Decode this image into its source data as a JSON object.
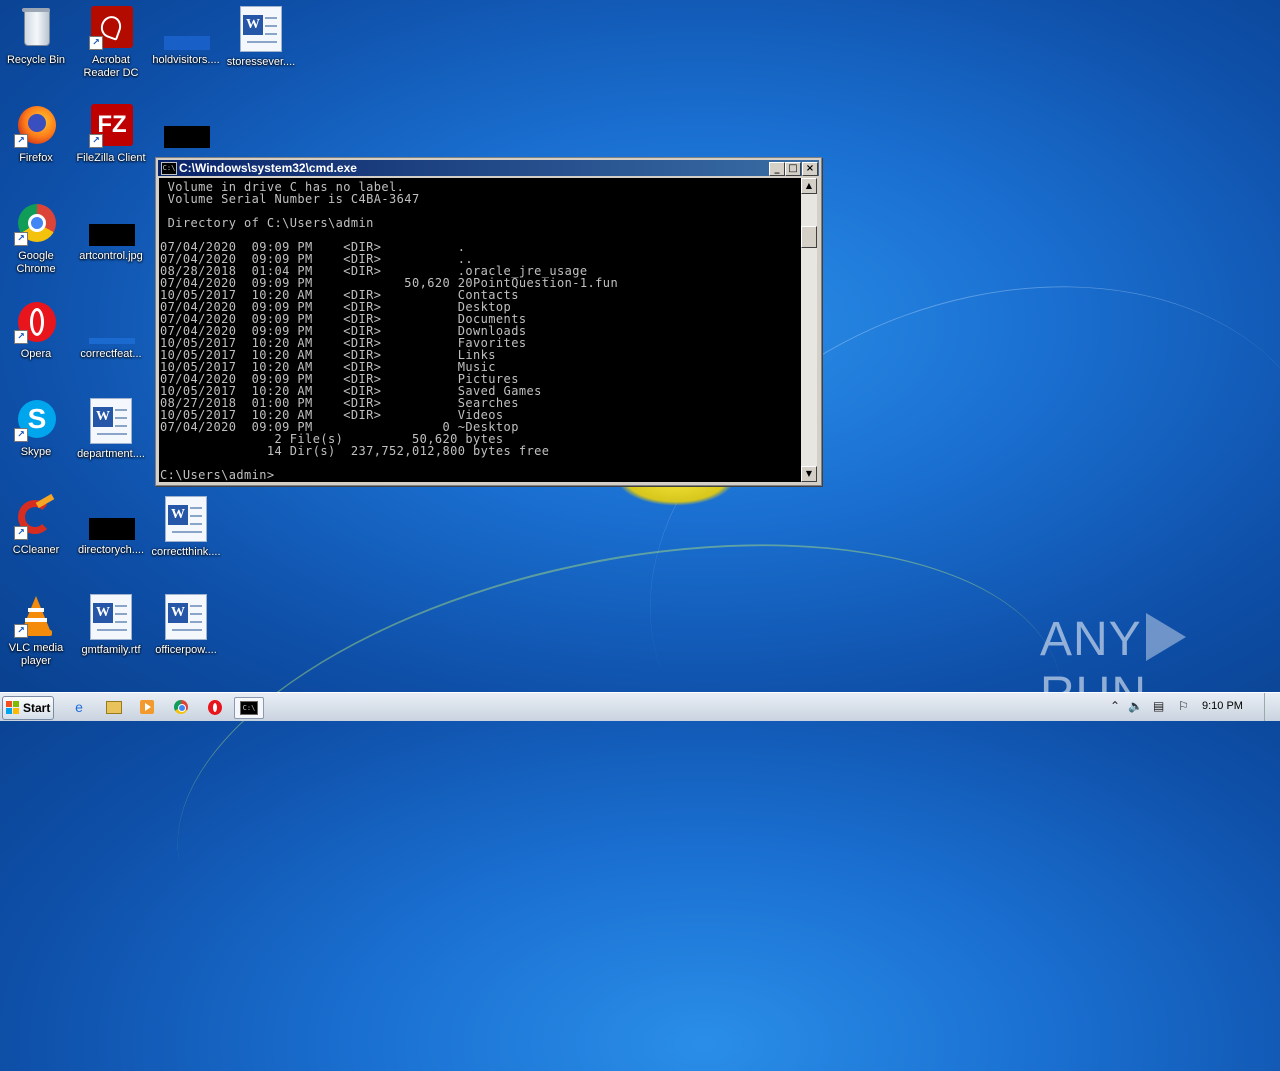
{
  "desktop": {
    "icons": [
      {
        "label": "Recycle Bin",
        "icon": "recycle-bin-icon"
      },
      {
        "label": "Acrobat Reader DC",
        "icon": "acrobat-icon"
      },
      {
        "label": "holdvisitors....",
        "icon": "file-icon"
      },
      {
        "label": "storessever....",
        "icon": "word-document-icon"
      },
      {
        "label": "Firefox",
        "icon": "firefox-icon"
      },
      {
        "label": "FileZilla Client",
        "icon": "filezilla-icon"
      },
      {
        "label": "",
        "icon": "file-icon"
      },
      {
        "label": "Google Chrome",
        "icon": "chrome-icon"
      },
      {
        "label": "artcontrol.jpg",
        "icon": "image-file-icon"
      },
      {
        "label": "Opera",
        "icon": "opera-icon"
      },
      {
        "label": "correctfeat...",
        "icon": "file-icon"
      },
      {
        "label": "Skype",
        "icon": "skype-icon"
      },
      {
        "label": "department....",
        "icon": "word-document-icon"
      },
      {
        "label": "CCleaner",
        "icon": "ccleaner-icon"
      },
      {
        "label": "directorych....",
        "icon": "file-icon"
      },
      {
        "label": "correctthink....",
        "icon": "word-document-icon"
      },
      {
        "label": "VLC media player",
        "icon": "vlc-icon"
      },
      {
        "label": "gmtfamily.rtf",
        "icon": "word-document-icon"
      },
      {
        "label": "officerpow....",
        "icon": "word-document-icon"
      }
    ]
  },
  "cmd_window": {
    "title": "C:\\Windows\\system32\\cmd.exe",
    "lines": [
      " Volume in drive C has no label.",
      " Volume Serial Number is C4BA-3647",
      "",
      " Directory of C:\\Users\\admin",
      "",
      "07/04/2020  09:09 PM    <DIR>          .",
      "07/04/2020  09:09 PM    <DIR>          ..",
      "08/28/2018  01:04 PM    <DIR>          .oracle_jre_usage",
      "07/04/2020  09:09 PM            50,620 20PointQuestion-1.fun",
      "10/05/2017  10:20 AM    <DIR>          Contacts",
      "07/04/2020  09:09 PM    <DIR>          Desktop",
      "07/04/2020  09:09 PM    <DIR>          Documents",
      "07/04/2020  09:09 PM    <DIR>          Downloads",
      "10/05/2017  10:20 AM    <DIR>          Favorites",
      "10/05/2017  10:20 AM    <DIR>          Links",
      "10/05/2017  10:20 AM    <DIR>          Music",
      "07/04/2020  09:09 PM    <DIR>          Pictures",
      "10/05/2017  10:20 AM    <DIR>          Saved Games",
      "08/27/2018  01:00 PM    <DIR>          Searches",
      "10/05/2017  10:20 AM    <DIR>          Videos",
      "07/04/2020  09:09 PM                 0 ~Desktop",
      "               2 File(s)         50,620 bytes",
      "              14 Dir(s)  237,752,012,800 bytes free",
      "",
      "C:\\Users\\admin>"
    ]
  },
  "watermark": {
    "left": "ANY",
    "right": "RUN"
  },
  "taskbar": {
    "start_label": "Start",
    "items": [
      "ie-icon",
      "explorer-icon",
      "media-player-icon",
      "chrome-icon",
      "opera-icon",
      "cmd-icon"
    ],
    "clock": "9:10 PM"
  }
}
